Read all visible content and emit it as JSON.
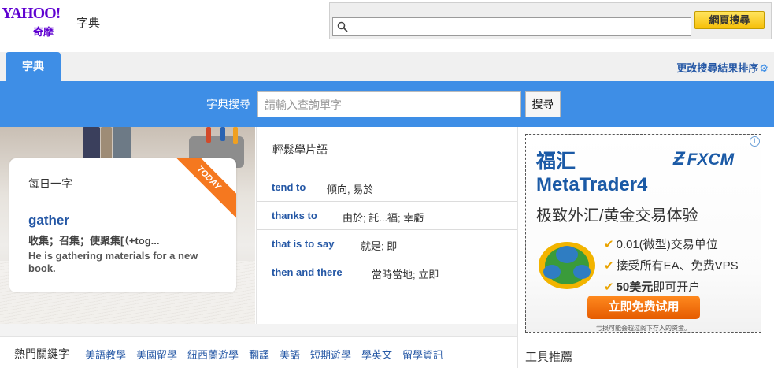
{
  "header": {
    "logo_yahoo": "YAHOO!",
    "logo_kimo": "奇摩",
    "logo_dict": "字典",
    "top_search": {
      "placeholder": "",
      "button_label": "網頁搜尋"
    }
  },
  "tabs": {
    "active_tab": "字典",
    "sort_link": "更改搜尋結果排序",
    "sort_icon": "⚙"
  },
  "dict_search": {
    "label": "字典搜尋",
    "placeholder": "請輸入查詢單字",
    "button_label": "搜尋"
  },
  "word_of_day": {
    "title": "每日一字",
    "ribbon": "TODAY",
    "word": "gather",
    "definition": "收集；召集；使聚集[（+tog...",
    "example": "He is gathering materials for a new book."
  },
  "phrases": {
    "title": "輕鬆學片語",
    "items": [
      {
        "en": "tend to",
        "zh": "傾向, 易於"
      },
      {
        "en": "thanks to",
        "zh": "由於; 託...福; 幸虧"
      },
      {
        "en": "that is to say",
        "zh": "就是; 即"
      },
      {
        "en": "then and there",
        "zh": "當時當地; 立即"
      }
    ]
  },
  "hot_keywords": {
    "label": "熱門關鍵字",
    "items": [
      "美語教學",
      "美國留學",
      "紐西蘭遊學",
      "翻譯",
      "美語",
      "短期遊學",
      "學英文",
      "留學資訊"
    ]
  },
  "ad": {
    "info_icon": "i",
    "title": "福汇",
    "brand": "FXCM",
    "headline": "MetaTrader4",
    "subtitle": "极致外汇/黄金交易体验",
    "bullets": [
      {
        "text": "0.01(微型)交易单位",
        "highlight": ""
      },
      {
        "text": "接受所有EA、免费VPS",
        "highlight": ""
      },
      {
        "text": "即可开户",
        "highlight": "50美元"
      }
    ],
    "cta": "立即免费试用",
    "disclaimer": "亏损可能会超过阁下存入的资金。"
  },
  "tools": {
    "title": "工具推薦"
  },
  "colors": {
    "accent_blue": "#3e8ee6",
    "link": "#2457a5",
    "ribbon": "#f5781f",
    "yahoo_purple": "#5f01d1"
  }
}
